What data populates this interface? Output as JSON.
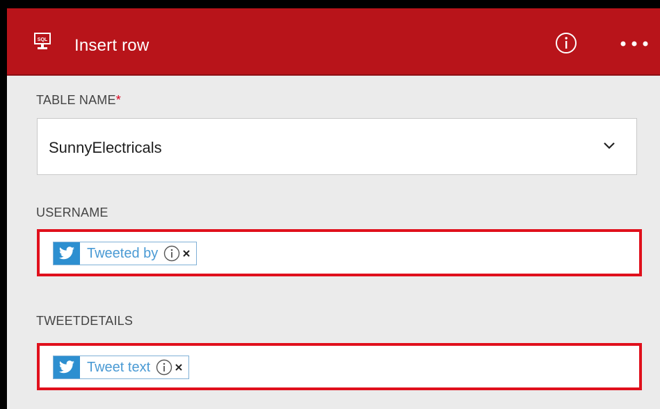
{
  "header": {
    "icon": "sql-monitor-icon",
    "title": "Insert row",
    "background": "#b8141a"
  },
  "fields": {
    "table_name": {
      "label": "TABLE NAME",
      "required_marker": "*",
      "value": "SunnyElectricals"
    },
    "username": {
      "label": "USERNAME",
      "token": {
        "text": "Tweeted by",
        "source_icon": "twitter-icon"
      }
    },
    "tweetdetails": {
      "label": "TWEETDETAILS",
      "token": {
        "text": "Tweet text",
        "source_icon": "twitter-icon"
      }
    }
  },
  "colors": {
    "highlight": "#e0101c",
    "token_blue": "#2d8fd0",
    "required": "#d9001b"
  }
}
